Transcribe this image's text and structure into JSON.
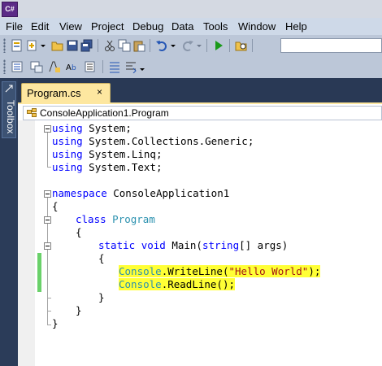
{
  "app": {
    "icon_text": "C#"
  },
  "menu": [
    "File",
    "Edit",
    "View",
    "Project",
    "Debug",
    "Data",
    "Tools",
    "Window",
    "Help"
  ],
  "toolbox": {
    "label": "Toolbox"
  },
  "document_tab": {
    "label": "Program.cs",
    "close": "×"
  },
  "navigation": {
    "type_combo": "ConsoleApplication1.Program"
  },
  "code_lines": [
    {
      "kw": "using",
      "rest": " System;"
    },
    {
      "kw": "using",
      "rest": " System.Collections.Generic;"
    },
    {
      "kw": "using",
      "rest": " System.Linq;"
    },
    {
      "kw": "using",
      "rest": " System.Text;"
    },
    {
      "kw": "namespace",
      "rest": " ConsoleApplication1"
    },
    {
      "text": "{"
    },
    {
      "kw": "class",
      "type": "Program"
    },
    {
      "text": "{"
    },
    {
      "kw1": "static",
      "kw2": "void",
      "rest": " Main(",
      "kw3": "string",
      "rest2": "[] args)"
    },
    {
      "text": "{"
    },
    {
      "type": "Console",
      "rest": ".WriteLine(",
      "str": "\"Hello World\"",
      "rest2": ");"
    },
    {
      "type": "Console",
      "rest": ".ReadLine();"
    },
    {
      "text": "}"
    },
    {
      "text": "}"
    },
    {
      "text": "}"
    }
  ],
  "colors": {
    "keyword": "#0000ff",
    "type": "#2b91af",
    "string": "#a31515",
    "highlight": "#ffff35",
    "changed_line": "#6ad16a",
    "tab_active": "#fde7a0"
  },
  "toolbar_icons": [
    "new-project-icon",
    "add-item-icon",
    "open-icon",
    "save-icon",
    "save-all-icon",
    "cut-icon",
    "copy-icon",
    "paste-icon",
    "undo-icon",
    "redo-icon",
    "start-debug-icon",
    "find-icon"
  ]
}
